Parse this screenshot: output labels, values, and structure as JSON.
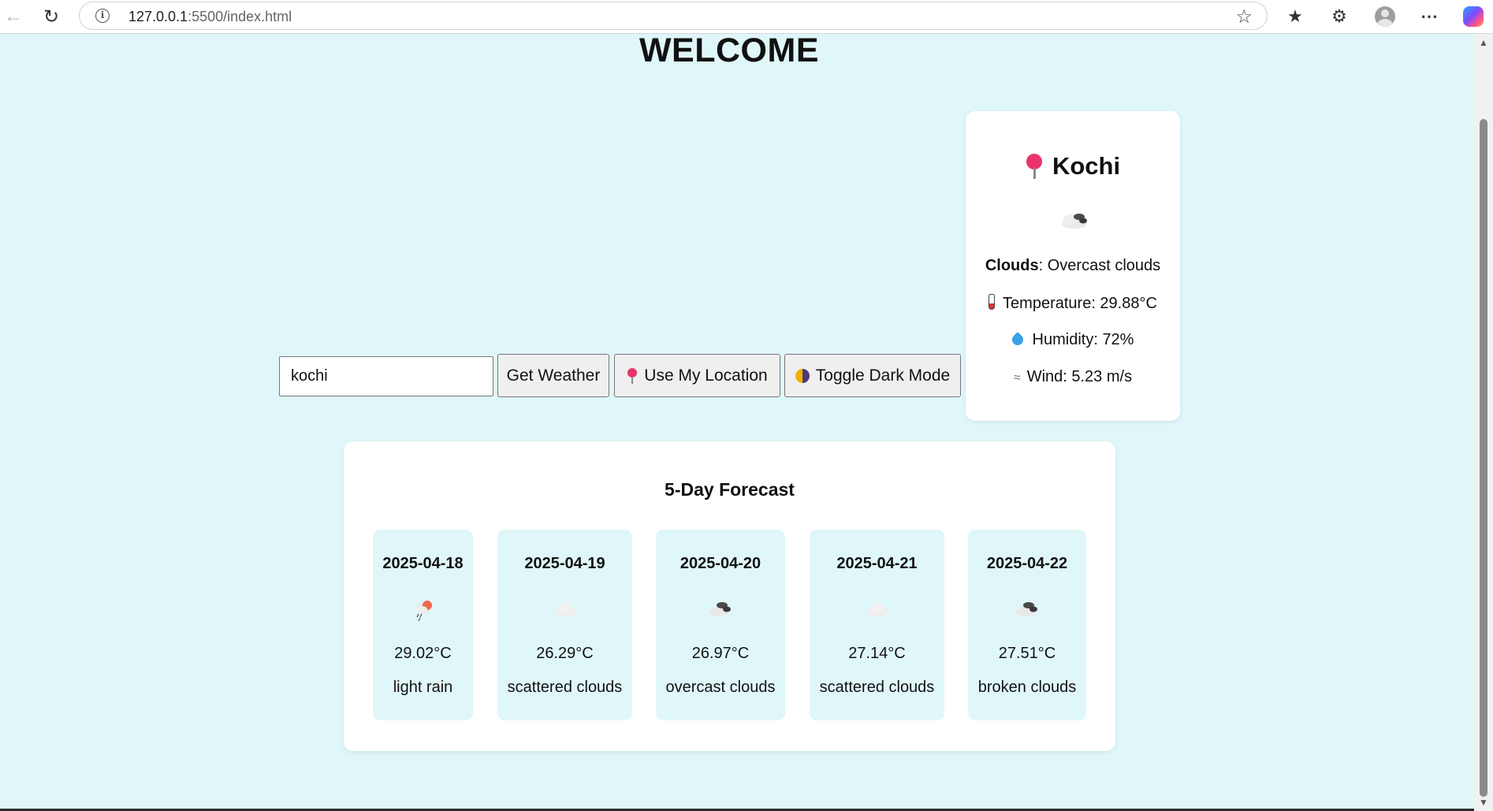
{
  "browser": {
    "url_host": "127.0.0.1",
    "url_path": ":5500/index.html"
  },
  "page": {
    "title": "WELCOME"
  },
  "search": {
    "value": "kochi",
    "get_weather_label": "Get Weather",
    "use_location_label": "Use My Location",
    "dark_mode_label": "Toggle Dark Mode"
  },
  "current": {
    "city": "Kochi",
    "icon": "broken-clouds-icon",
    "condition_main": "Clouds",
    "condition_desc": ": Overcast clouds",
    "temperature": "Temperature: 29.88°C",
    "humidity": "Humidity: 72%",
    "wind": "Wind: 5.23 m/s"
  },
  "forecast": {
    "title": "5-Day Forecast",
    "days": [
      {
        "date": "2025-04-18",
        "icon": "light-rain-icon",
        "temp": "29.02°C",
        "desc": "light rain"
      },
      {
        "date": "2025-04-19",
        "icon": "scattered-clouds-icon",
        "temp": "26.29°C",
        "desc": "scattered clouds"
      },
      {
        "date": "2025-04-20",
        "icon": "overcast-clouds-icon",
        "temp": "26.97°C",
        "desc": "overcast clouds"
      },
      {
        "date": "2025-04-21",
        "icon": "scattered-clouds-icon",
        "temp": "27.14°C",
        "desc": "scattered clouds"
      },
      {
        "date": "2025-04-22",
        "icon": "broken-clouds-icon",
        "temp": "27.51°C",
        "desc": "broken clouds"
      }
    ]
  },
  "colors": {
    "page_background": "#e0f7fa",
    "card_background": "#ffffff",
    "pin": "#e8346b"
  }
}
